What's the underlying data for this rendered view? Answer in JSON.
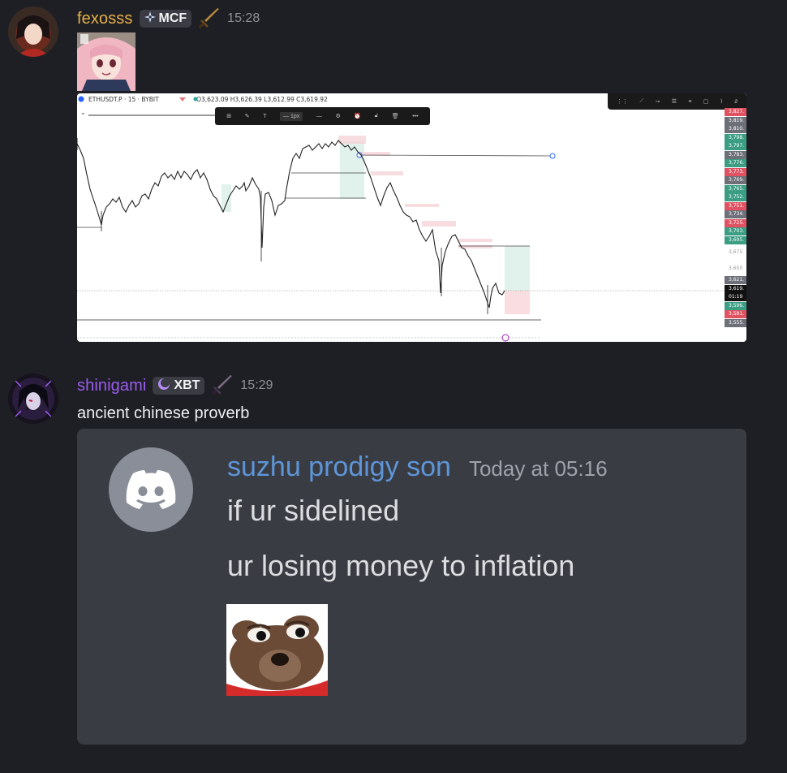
{
  "messages": [
    {
      "username": "fexosss",
      "username_color": "#e8b04b",
      "tag": "MCF",
      "tag_icon": "compass-star-icon",
      "role_icon": "sword-icon",
      "time": "15:28",
      "attachments": [
        "anime-girl-image",
        "tradingview-chart-screenshot"
      ]
    },
    {
      "username": "shinigami",
      "username_color": "#9b5cf0",
      "tag": "XBT",
      "tag_icon": "crescent-moon-icon",
      "role_icon": "sword-icon",
      "time": "15:29",
      "text": "ancient chinese proverb"
    }
  ],
  "chart": {
    "symbol_line": "ETHUSDT.P · 15 · BYBIT",
    "ohlc": "O3,623.09 H3,626.39 L3,612.99 C3,619.92",
    "line_width_label": "1px",
    "price_tags": [
      {
        "label": "3,827.",
        "color": "#e05262"
      },
      {
        "label": "3,819.",
        "color": "#6e7079"
      },
      {
        "label": "3,810.",
        "color": "#6e7079"
      },
      {
        "label": "3,798.",
        "color": "#3b9e84"
      },
      {
        "label": "3,797.",
        "color": "#3b9e84"
      },
      {
        "label": "3,783.",
        "color": "#6e7079"
      },
      {
        "label": "3,776.",
        "color": "#3b9e84"
      },
      {
        "label": "3,773.",
        "color": "#e05262"
      },
      {
        "label": "3,769.",
        "color": "#6e7079"
      },
      {
        "label": "3,765.",
        "color": "#3b9e84"
      },
      {
        "label": "3,752.",
        "color": "#3b9e84"
      },
      {
        "label": "3,751.",
        "color": "#e05262"
      },
      {
        "label": "3,734.",
        "color": "#6e7079"
      },
      {
        "label": "3,725.",
        "color": "#e05262"
      },
      {
        "label": "3,703.",
        "color": "#3b9e84"
      },
      {
        "label": "3,695.",
        "color": "#3b9e84"
      },
      {
        "label": "3,675",
        "color": "plain"
      },
      {
        "label": "3,650",
        "color": "plain"
      },
      {
        "label": "3,621.",
        "color": "#6e7079"
      },
      {
        "label": "3,619.",
        "color": "#111111"
      },
      {
        "label": "01:19",
        "color": "#111111"
      },
      {
        "label": "3,596.",
        "color": "#3b9e84"
      },
      {
        "label": "3,581.",
        "color": "#e05262"
      },
      {
        "label": "3,555.",
        "color": "#6e7079"
      }
    ]
  },
  "embed": {
    "author": "suzhu prodigy son",
    "timestamp": "Today at 05:16",
    "line1": "if ur sidelined",
    "line2": "ur losing money to inflation",
    "avatar_icon": "discord-logo-icon",
    "image": "pepe-emoji"
  }
}
